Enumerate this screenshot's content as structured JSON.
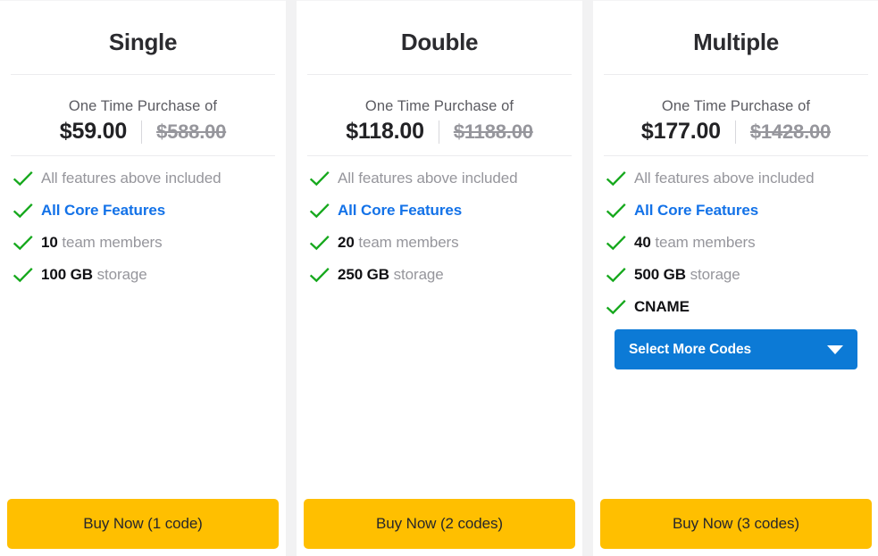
{
  "colors": {
    "accent_blue": "#1372e8",
    "dropdown_blue": "#0c7ad6",
    "buy_yellow": "#ffbf00",
    "check_green": "#15a81c",
    "muted_text": "#96969c",
    "dark_text": "#111114",
    "page_background": "#f2f2f3"
  },
  "plans": [
    {
      "title": "Single",
      "price_caption": "One Time Purchase of",
      "price_now": "$59.00",
      "price_was": "$588.00",
      "features": [
        {
          "prefix": "",
          "text": "All features above included",
          "style": "muted"
        },
        {
          "prefix": "",
          "text": "All Core Features",
          "style": "accent"
        },
        {
          "prefix": "10",
          "text": "team members",
          "style": "muted"
        },
        {
          "prefix": "100 GB",
          "text": "storage",
          "style": "muted"
        }
      ],
      "has_dropdown": false,
      "dropdown_label": "",
      "buy_label": "Buy Now (1 code)"
    },
    {
      "title": "Double",
      "price_caption": "One Time Purchase of",
      "price_now": "$118.00",
      "price_was": "$1188.00",
      "features": [
        {
          "prefix": "",
          "text": "All features above included",
          "style": "muted"
        },
        {
          "prefix": "",
          "text": "All Core Features",
          "style": "accent"
        },
        {
          "prefix": "20",
          "text": "team members",
          "style": "muted"
        },
        {
          "prefix": "250 GB",
          "text": "storage",
          "style": "muted"
        }
      ],
      "has_dropdown": false,
      "dropdown_label": "",
      "buy_label": "Buy Now (2 codes)"
    },
    {
      "title": "Multiple",
      "price_caption": "One Time Purchase of",
      "price_now": "$177.00",
      "price_was": "$1428.00",
      "features": [
        {
          "prefix": "",
          "text": "All features above included",
          "style": "muted"
        },
        {
          "prefix": "",
          "text": "All Core Features",
          "style": "accent"
        },
        {
          "prefix": "40",
          "text": "team members",
          "style": "muted"
        },
        {
          "prefix": "500 GB",
          "text": "storage",
          "style": "muted"
        },
        {
          "prefix": "",
          "text": "CNAME",
          "style": "dark"
        }
      ],
      "has_dropdown": true,
      "dropdown_label": "Select More Codes",
      "buy_label": "Buy Now (3 codes)"
    }
  ],
  "icons": {
    "check": "check-icon",
    "caret": "chevron-down-icon"
  }
}
